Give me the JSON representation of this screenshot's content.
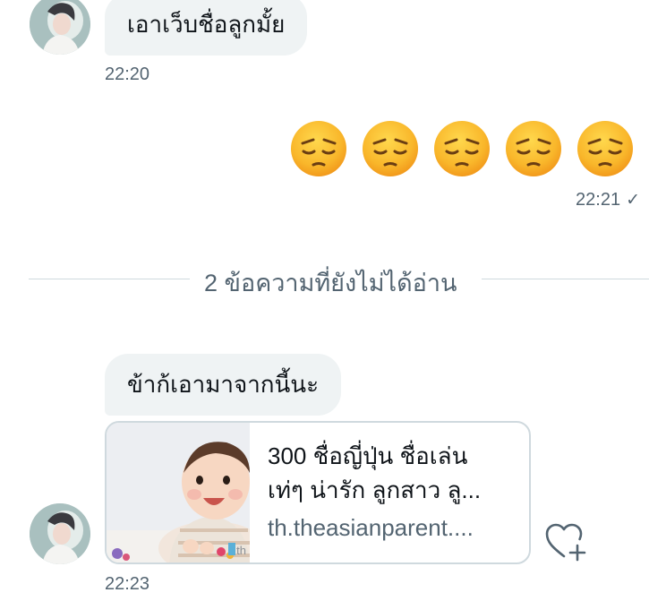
{
  "messages": {
    "first": {
      "text": "เอาเว็บชื่อลูกมั้ย",
      "time": "22:20"
    },
    "reply": {
      "emoji": [
        "😔",
        "😔",
        "😔",
        "😔",
        "😔"
      ],
      "time": "22:21",
      "status": "✓"
    },
    "unread_divider": "2 ข้อความที่ยังไม่ได้อ่าน",
    "second": {
      "text": "ข้าก้เอามาจากนี้นะ"
    },
    "link_card": {
      "title_line1": "300 ชื่อญี่ปุ่น ชื่อเล่น",
      "title_line2": "เท่ๆ น่ารัก ลูกสาว ลู...",
      "domain": "th.theasianparent....",
      "thumb_watermark": "th"
    },
    "last_time": "22:23"
  },
  "icons": {
    "react": "heart-plus-icon",
    "read_receipt": "check-icon"
  },
  "colors": {
    "incoming_bubble": "#eff3f4",
    "secondary_text": "#536471",
    "divider": "#cfd9de"
  }
}
